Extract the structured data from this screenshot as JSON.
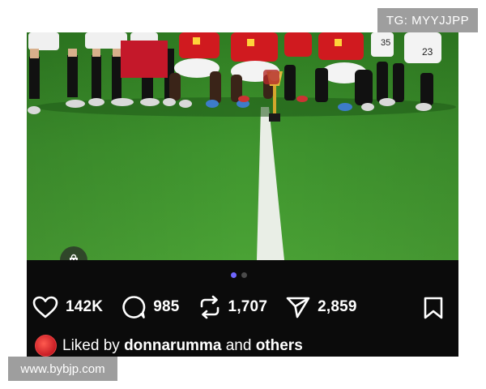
{
  "watermark_top": "TG: MYYJJPP",
  "watermark_bottom": "www.bybjp.com",
  "photo": {
    "shop_icon": "shopping-bag-icon",
    "carousel_total": 2,
    "carousel_active": 1
  },
  "actions": {
    "like": {
      "icon": "heart-icon",
      "count": "142K"
    },
    "comment": {
      "icon": "comment-icon",
      "count": "985"
    },
    "repost": {
      "icon": "repost-icon",
      "count": "1,707"
    },
    "share": {
      "icon": "send-icon",
      "count": "2,859"
    },
    "save": {
      "icon": "bookmark-icon"
    }
  },
  "liked_by": {
    "prefix": "Liked by",
    "user": "donnarumma",
    "joiner": "and",
    "suffix": "others"
  },
  "colors": {
    "panel_bg": "#0b0b0b",
    "active_dot": "#6f66ff",
    "watermark_bg": "#9e9e9e",
    "jersey_red": "#d01a1f"
  }
}
